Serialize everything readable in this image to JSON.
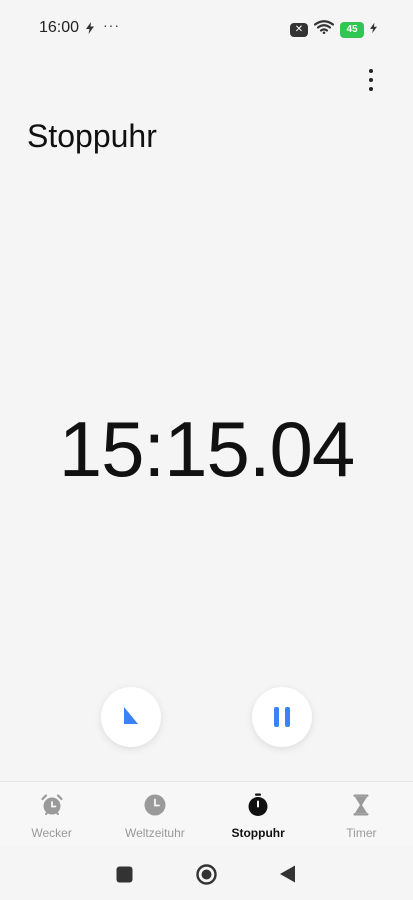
{
  "status_bar": {
    "time": "16:00",
    "dots": "···",
    "sim_badge": "✕",
    "battery_level": "45"
  },
  "header": {
    "title": "Stoppuhr"
  },
  "stopwatch": {
    "time": "15:15.04"
  },
  "bottom_nav": {
    "items": [
      {
        "label": "Wecker",
        "icon": "alarm-clock-icon"
      },
      {
        "label": "Weltzeituhr",
        "icon": "world-clock-icon"
      },
      {
        "label": "Stoppuhr",
        "icon": "stopwatch-icon",
        "active": true
      },
      {
        "label": "Timer",
        "icon": "hourglass-icon"
      }
    ]
  },
  "colors": {
    "accent": "#3b82f6",
    "battery": "#31c553",
    "background": "#f5f5f5"
  }
}
